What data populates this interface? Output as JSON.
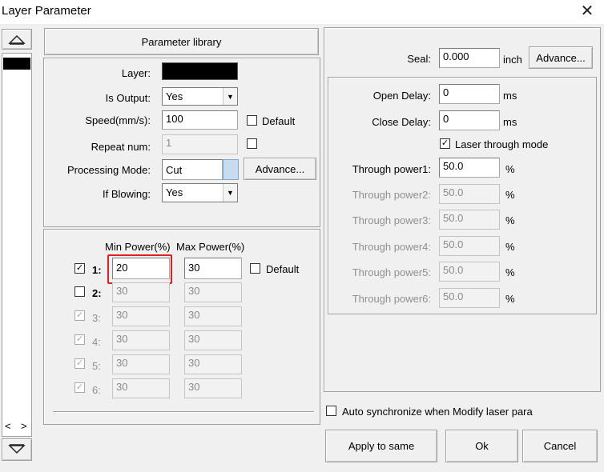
{
  "window": {
    "title": "Layer Parameter"
  },
  "left_panel": {
    "scroll_left": "<",
    "scroll_right": ">"
  },
  "library_button": "Parameter library",
  "layer": {
    "layer_label": "Layer:",
    "layer_color": "#000000",
    "is_output_label": "Is Output:",
    "is_output_value": "Yes",
    "speed_label": "Speed(mm/s):",
    "speed_value": "100",
    "default_label": "Default",
    "repeat_label": "Repeat num:",
    "repeat_value": "1",
    "mode_label": "Processing Mode:",
    "mode_value": "Cut",
    "advance_label": "Advance...",
    "blowing_label": "If Blowing:",
    "blowing_value": "Yes"
  },
  "power": {
    "min_header": "Min Power(%)",
    "max_header": "Max Power(%)",
    "default_label": "Default",
    "rows": [
      {
        "label": "1:",
        "checked": "✓",
        "min": "20",
        "max": "30"
      },
      {
        "label": "2:",
        "checked": "",
        "min": "30",
        "max": "30"
      },
      {
        "label": "3:",
        "checked": "✓",
        "min": "30",
        "max": "30"
      },
      {
        "label": "4:",
        "checked": "✓",
        "min": "30",
        "max": "30"
      },
      {
        "label": "5:",
        "checked": "✓",
        "min": "30",
        "max": "30"
      },
      {
        "label": "6:",
        "checked": "✓",
        "min": "30",
        "max": "30"
      }
    ]
  },
  "right": {
    "seal_label": "Seal:",
    "seal_value": "0.000",
    "seal_unit": "inch",
    "advance_label": "Advance...",
    "open_delay_label": "Open Delay:",
    "open_delay_value": "0",
    "close_delay_label": "Close Delay:",
    "close_delay_value": "0",
    "ms_unit": "ms",
    "laser_through_label": "Laser through mode",
    "laser_through_checked": "✓",
    "through": [
      {
        "label": "Through power1:",
        "value": "50.0"
      },
      {
        "label": "Through power2:",
        "value": "50.0"
      },
      {
        "label": "Through power3:",
        "value": "50.0"
      },
      {
        "label": "Through power4:",
        "value": "50.0"
      },
      {
        "label": "Through power5:",
        "value": "50.0"
      },
      {
        "label": "Through power6:",
        "value": "50.0"
      }
    ],
    "percent_unit": "%"
  },
  "bottom": {
    "auto_sync_label": "Auto synchronize when Modify laser para",
    "apply_label": "Apply to same",
    "ok_label": "Ok",
    "cancel_label": "Cancel"
  }
}
